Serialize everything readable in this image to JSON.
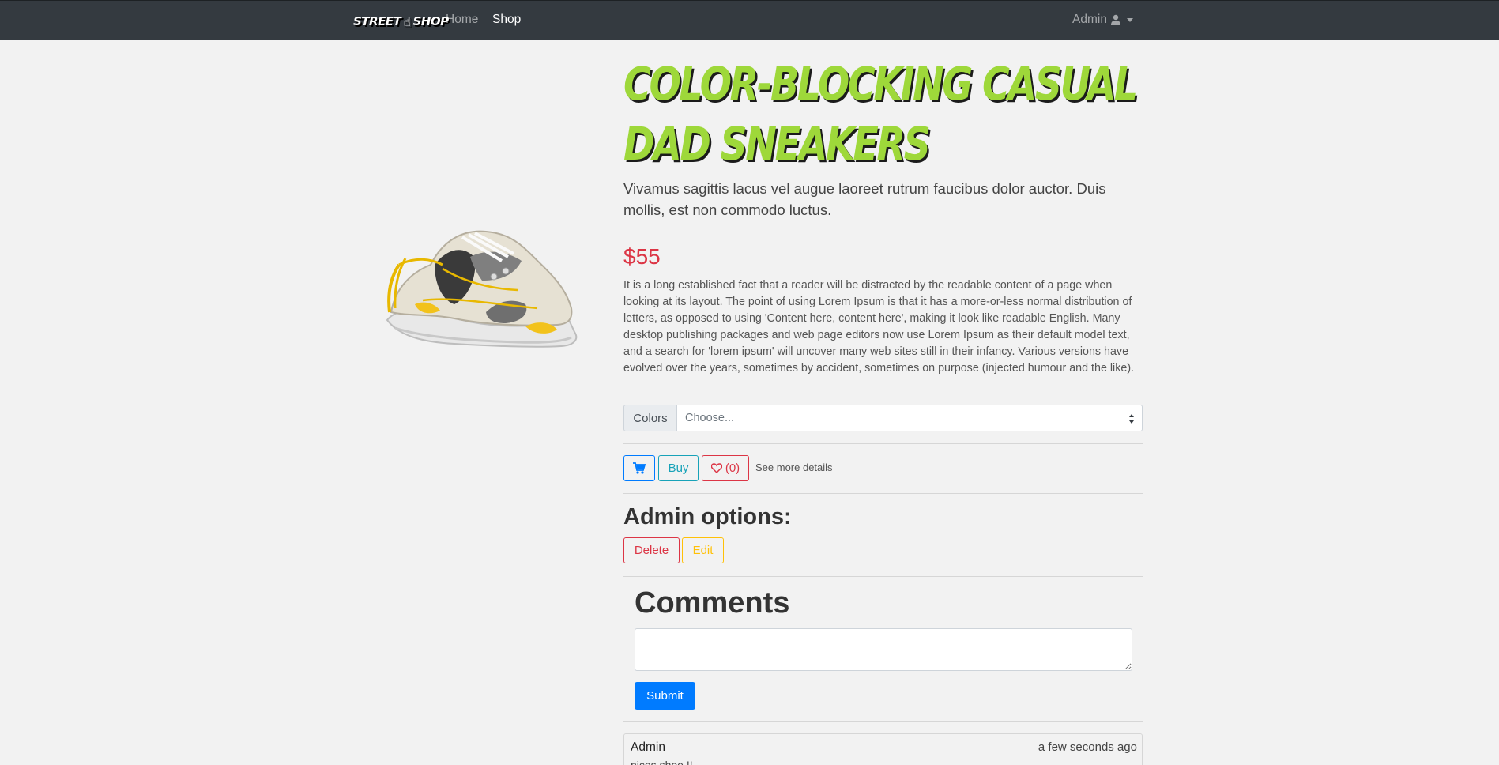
{
  "navbar": {
    "brand_left": "STREET",
    "brand_right": "SHOP",
    "home": "Home",
    "shop": "Shop",
    "admin": "Admin"
  },
  "product": {
    "title": "Color-Blocking Casual Dad Sneakers",
    "subtitle": "Vivamus sagittis lacus vel augue laoreet rutrum faucibus dolor auctor. Duis mollis, est non commodo luctus.",
    "price": "$55",
    "description": "It is a long established fact that a reader will be distracted by the readable content of a page when looking at its layout. The point of using Lorem Ipsum is that it has a more-or-less normal distribution of letters, as opposed to using 'Content here, content here', making it look like readable English. Many desktop publishing packages and web page editors now use Lorem Ipsum as their default model text, and a search for 'lorem ipsum' will uncover many web sites still in their infancy. Various versions have evolved over the years, sometimes by accident, sometimes on purpose (injected humour and the like)."
  },
  "colors": {
    "label": "Colors",
    "selected": "Choose..."
  },
  "actions": {
    "buy": "Buy",
    "wishlist_count": "(0)",
    "see_more": "See more details"
  },
  "admin": {
    "heading": "Admin options:",
    "delete": "Delete",
    "edit": "Edit"
  },
  "comments": {
    "heading": "Comments",
    "submit": "Submit",
    "items": [
      {
        "author": "Admin",
        "time": "a few seconds ago",
        "text": "nices shoe !!"
      }
    ]
  },
  "theme": {
    "title_color": "#9ed83a",
    "price_color": "#dc3545",
    "primary": "#007bff",
    "info": "#17a2b8",
    "warning": "#ffc107",
    "navbar_bg": "#343a40"
  }
}
